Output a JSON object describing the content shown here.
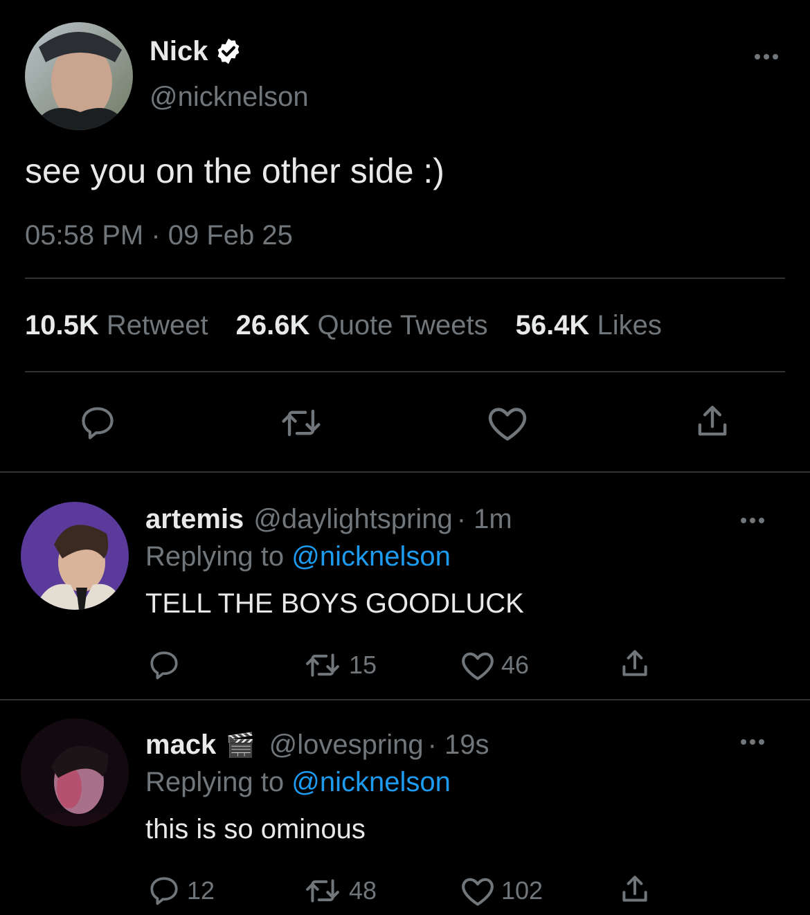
{
  "tweet": {
    "name": "Nick",
    "handle": "@nicknelson",
    "text": "see you on the other side :)",
    "timestamp": "05:58 PM · 09 Feb 25",
    "stats": {
      "retweets_count": "10.5K",
      "retweets_label": "Retweet",
      "quotes_count": "26.6K",
      "quotes_label": "Quote Tweets",
      "likes_count": "56.4K",
      "likes_label": "Likes"
    },
    "icons": [
      "reply-icon",
      "retweet-icon",
      "like-icon",
      "share-icon"
    ]
  },
  "replies": [
    {
      "name": "artemis",
      "handle": "@daylightspring",
      "time": "· 1m",
      "replying_prefix": "Replying to",
      "replying_to": "@nicknelson",
      "text": "TELL THE BOYS GOODLUCK",
      "reply_count": "",
      "retweet_count": "15",
      "like_count": "46"
    },
    {
      "name": "mack",
      "name_emoji": "🎬",
      "handle": "@lovespring",
      "time": "· 19s",
      "replying_prefix": "Replying to",
      "replying_to": "@nicknelson",
      "text": "this is so ominous",
      "reply_count": "12",
      "retweet_count": "48",
      "like_count": "102"
    }
  ],
  "colors": {
    "background": "#000000",
    "text": "#e7e9ea",
    "muted": "#71767b",
    "link": "#1d9bf0",
    "verified": "#ffffff"
  }
}
